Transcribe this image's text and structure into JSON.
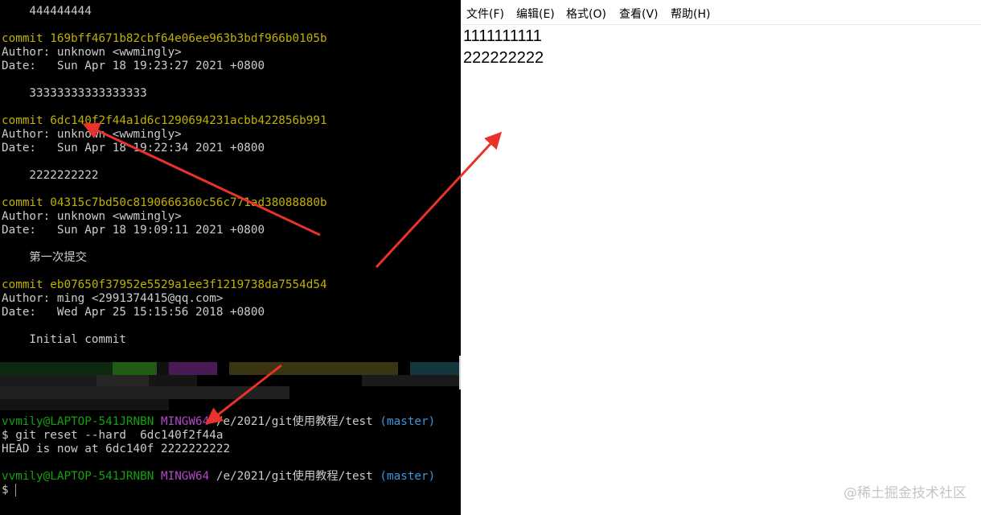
{
  "terminal": {
    "log": [
      {
        "text": "    444444444",
        "cls": "ink"
      },
      {
        "text": "",
        "cls": "ink"
      },
      {
        "text": "commit 169bff4671b82cbf64e06ee963b3bdf966b0105b",
        "cls": "yellow"
      },
      {
        "text": "Author: unknown <wwmingly>",
        "cls": "ink"
      },
      {
        "text": "Date:   Sun Apr 18 19:23:27 2021 +0800",
        "cls": "ink"
      },
      {
        "text": "",
        "cls": "ink"
      },
      {
        "text": "    33333333333333333",
        "cls": "ink"
      },
      {
        "text": "",
        "cls": "ink"
      },
      {
        "text": "commit 6dc140f2f44a1d6c1290694231acbb422856b991",
        "cls": "yellow"
      },
      {
        "text": "Author: unknown <wwmingly>",
        "cls": "ink"
      },
      {
        "text": "Date:   Sun Apr 18 19:22:34 2021 +0800",
        "cls": "ink"
      },
      {
        "text": "",
        "cls": "ink"
      },
      {
        "text": "    2222222222",
        "cls": "ink"
      },
      {
        "text": "",
        "cls": "ink"
      },
      {
        "text": "commit 04315c7bd50c8190666360c56c771ad38088880b",
        "cls": "yellow"
      },
      {
        "text": "Author: unknown <wwmingly>",
        "cls": "ink"
      },
      {
        "text": "Date:   Sun Apr 18 19:09:11 2021 +0800",
        "cls": "ink"
      },
      {
        "text": "",
        "cls": "ink"
      },
      {
        "text": "    第一次提交",
        "cls": "ink"
      },
      {
        "text": "",
        "cls": "ink"
      },
      {
        "text": "commit eb07650f37952e5529a1ee3f1219738da7554d54",
        "cls": "yellow"
      },
      {
        "text": "Author: ming <2991374415@qq.com>",
        "cls": "ink"
      },
      {
        "text": "Date:   Wed Apr 25 15:15:56 2018 +0800",
        "cls": "ink"
      },
      {
        "text": "",
        "cls": "ink"
      },
      {
        "text": "    Initial commit",
        "cls": "ink"
      }
    ],
    "prompt1": {
      "user": "vvmily@LAPTOP-541JRNBN",
      "shell": "MINGW64",
      "path": "/e/2021/git使用教程/test",
      "branch": "(master)"
    },
    "command": "$ git reset --hard  6dc140f2f44a",
    "output": "HEAD is now at 6dc140f 2222222222",
    "prompt2": {
      "user": "vvmily@LAPTOP-541JRNBN",
      "shell": "MINGW64",
      "path": "/e/2021/git使用教程/test",
      "branch": "(master)"
    },
    "input_prompt": "$",
    "colors": {
      "background": "#000000",
      "commit": "#c0b000",
      "user": "#13a10e",
      "shell": "#b148c6",
      "branch": "#3a96dd"
    }
  },
  "notepad": {
    "menu": [
      "文件(F)",
      "编辑(E)",
      "格式(O)",
      "查看(V)",
      "帮助(H)"
    ],
    "lines": [
      "1111111111",
      "222222222"
    ]
  },
  "watermark": "@稀土掘金技术社区",
  "annotation_color": "#e8322b"
}
